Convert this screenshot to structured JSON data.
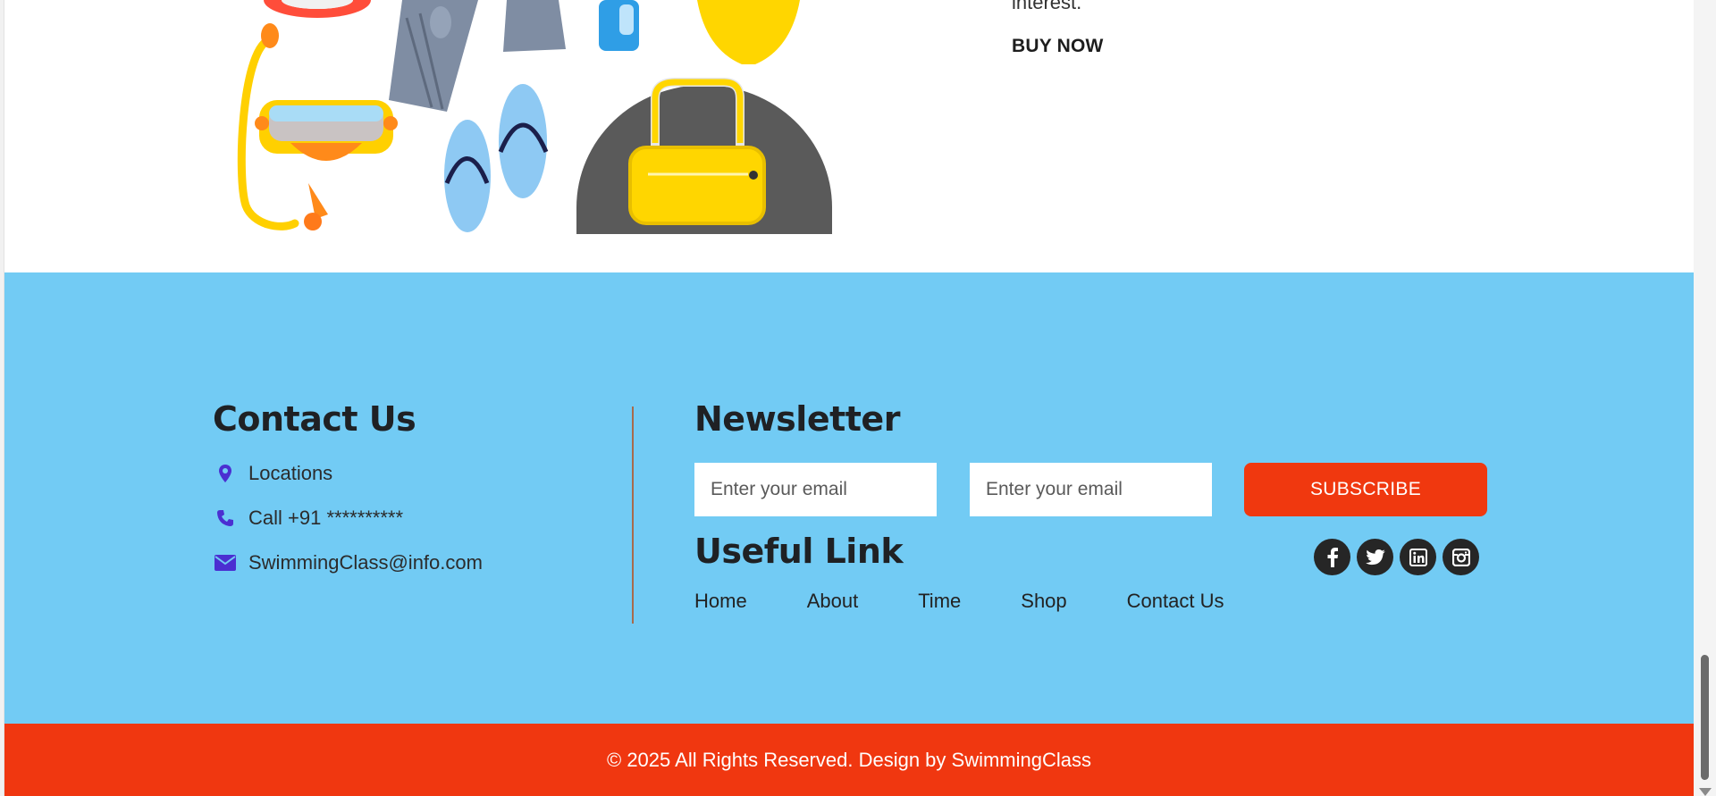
{
  "product": {
    "intro_tail": "interest.",
    "buy_now": "BUY NOW"
  },
  "footer": {
    "contact": {
      "heading": "Contact Us",
      "location": "Locations",
      "phone": "Call +91 **********",
      "email": "SwimmingClass@info.com"
    },
    "newsletter": {
      "heading": "Newsletter",
      "email_placeholder_1": "Enter your email",
      "email_placeholder_2": "Enter your email",
      "subscribe_label": "SUBSCRIBE"
    },
    "useful_links": {
      "heading": "Useful Link",
      "items": [
        "Home",
        "About",
        "Time",
        "Shop",
        "Contact Us"
      ]
    },
    "social": [
      "facebook-icon",
      "twitter-icon",
      "linkedin-icon",
      "instagram-icon"
    ]
  },
  "copyright": "© 2025 All Rights Reserved. Design by SwimmingClass",
  "colors": {
    "footer_bg": "#72cbf4",
    "accent": "#f0380f",
    "icon_purple": "#4b2fd1"
  }
}
